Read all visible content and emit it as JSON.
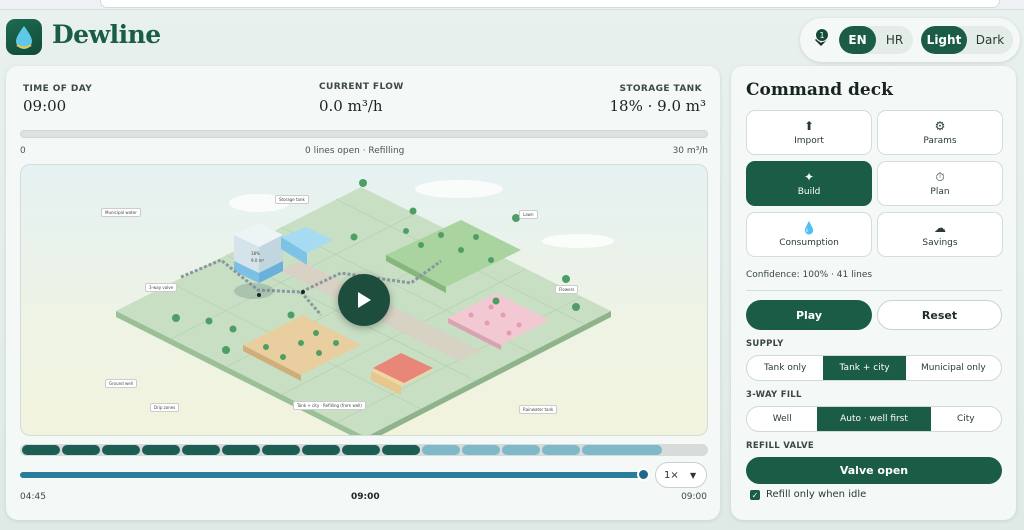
{
  "app": {
    "name": "Dewline"
  },
  "topbar": {
    "badge_count": "1",
    "languages": [
      "EN",
      "HR"
    ],
    "active_language": "EN",
    "themes": [
      "Light",
      "Dark"
    ],
    "active_theme": "Light"
  },
  "stats": {
    "time_label": "TIME OF DAY",
    "time_value": "09:00",
    "flow_label": "CURRENT FLOW",
    "flow_value": "0.0 m³/h",
    "tank_label": "STORAGE TANK",
    "tank_value": "18% · 9.0 m³"
  },
  "flow_scale": {
    "min": "0",
    "status": "0 lines open · Refilling",
    "max": "30 m³/h",
    "level": 0
  },
  "scene": {
    "labels": {
      "municipal": "Municipal water",
      "storage": "Storage tank",
      "tank_pct": "18%",
      "tank_vol": "9.0 m³",
      "valve": "3-way valve",
      "ground_well": "Ground well",
      "drip": "Drip zones",
      "lawn": "Lawn",
      "flowers": "Flowers",
      "rainwater": "Rainwater tank",
      "status": "Tank + city · Refilling (from well)"
    }
  },
  "playback": {
    "speed": "1×",
    "start": "04:45",
    "current": "09:00",
    "end": "09:00",
    "progress": 0.98,
    "segments": [
      {
        "state": "done"
      },
      {
        "state": "done"
      },
      {
        "state": "done"
      },
      {
        "state": "done"
      },
      {
        "state": "done"
      },
      {
        "state": "done"
      },
      {
        "state": "done"
      },
      {
        "state": "done"
      },
      {
        "state": "done"
      },
      {
        "state": "done"
      },
      {
        "state": "pending"
      },
      {
        "state": "pending"
      },
      {
        "state": "pending"
      },
      {
        "state": "pending"
      },
      {
        "state": "pending"
      }
    ]
  },
  "deck": {
    "title": "Command deck",
    "tiles": [
      {
        "label": "Import",
        "icon": "upload-icon",
        "glyph": "⬆"
      },
      {
        "label": "Params",
        "icon": "gear-icon",
        "glyph": "⚙"
      },
      {
        "label": "Build",
        "icon": "sparkle-icon",
        "glyph": "✦"
      },
      {
        "label": "Plan",
        "icon": "stopwatch-icon",
        "glyph": "⏱"
      },
      {
        "label": "Consumption",
        "icon": "droplet-icon",
        "glyph": "💧"
      },
      {
        "label": "Savings",
        "icon": "cloud-icon",
        "glyph": "☁"
      }
    ],
    "active_tile": "Build",
    "confidence": "Confidence: 100% · 41 lines",
    "play_label": "Play",
    "reset_label": "Reset",
    "supply_label": "SUPPLY",
    "supply_options": [
      "Tank only",
      "Tank + city",
      "Municipal only"
    ],
    "supply_selected": "Tank + city",
    "fill_label": "3-WAY FILL",
    "fill_options": [
      "Well",
      "Auto · well first",
      "City"
    ],
    "fill_selected": "Auto · well first",
    "refill_label": "REFILL VALVE",
    "valve_button": "Valve open",
    "refill_idle_label": "Refill only when idle",
    "refill_idle_checked": true
  },
  "colors": {
    "accent": "#1a5c45",
    "segment_done": "#1c5e56",
    "segment_pending": "#7fb8c6",
    "timeline": "#2a7c9b"
  }
}
